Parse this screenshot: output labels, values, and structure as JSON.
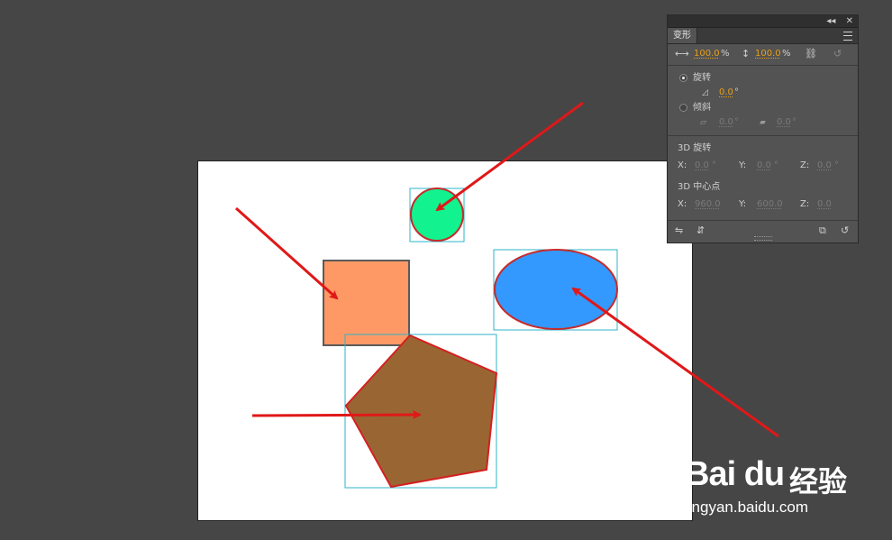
{
  "panel": {
    "tab": "变形",
    "collapse_label": "◂◂",
    "close_label": "✕",
    "scale": {
      "width_value": "100.0",
      "width_unit": "%",
      "height_value": "100.0",
      "height_unit": "%"
    },
    "rotate": {
      "label": "旋转",
      "value": "0.0",
      "unit": "°",
      "selected": true
    },
    "skew": {
      "label": "倾斜",
      "h_value": "0.0",
      "v_value": "0.0",
      "unit": "°",
      "selected": false
    },
    "rotate3d": {
      "title": "3D 旋转",
      "x_label": "X:",
      "x_value": "0.0",
      "x_unit": "°",
      "y_label": "Y:",
      "y_value": "0.0",
      "y_unit": "°",
      "z_label": "Z:",
      "z_value": "0.0",
      "z_unit": "°"
    },
    "center3d": {
      "title": "3D 中心点",
      "x_label": "X:",
      "x_value": "960.0",
      "y_label": "Y:",
      "y_value": "600.0",
      "z_label": "Z:",
      "z_value": "0.0"
    }
  },
  "canvas": {
    "shapes": [
      {
        "name": "circle",
        "fill": "#12f28f",
        "stroke": "#c62b2b"
      },
      {
        "name": "square",
        "fill": "#fe9966",
        "stroke": "#5a5a5a"
      },
      {
        "name": "ellipse",
        "fill": "#3399ff",
        "stroke": "#c62b2b"
      },
      {
        "name": "pentagon",
        "fill": "#996633",
        "stroke": "#d42020"
      }
    ],
    "selection_color": "#2bb5c9",
    "arrow_color": "#e01818"
  },
  "watermark": {
    "brand": "Bai du",
    "brand_cn": "经验",
    "url": "jingyan.baidu.com"
  },
  "icons": [
    "scale-width-icon",
    "scale-height-icon",
    "constrain-link-icon",
    "reset-scale-icon",
    "rotate-angle-icon",
    "skew-horizontal-icon",
    "skew-vertical-icon",
    "duplicate-transform-icon",
    "reset-transform-icon",
    "flip-horizontal-icon",
    "flip-vertical-icon",
    "paw-logo-icon"
  ]
}
